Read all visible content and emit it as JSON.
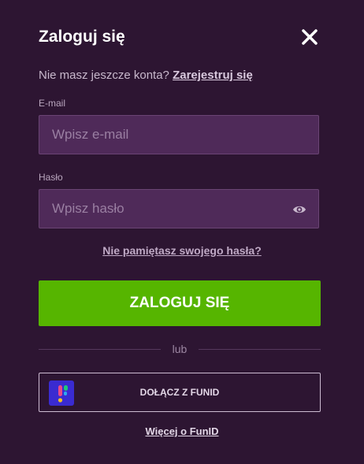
{
  "modal": {
    "title": "Zaloguj się"
  },
  "register": {
    "prompt": "Nie masz jeszcze konta?",
    "link_label": "Zarejestruj się"
  },
  "email": {
    "label": "E-mail",
    "placeholder": "Wpisz e-mail",
    "value": ""
  },
  "password": {
    "label": "Hasło",
    "placeholder": "Wpisz hasło",
    "value": ""
  },
  "forgot_password_label": "Nie pamiętasz swojego hasła?",
  "login_button_label": "ZALOGUJ SIĘ",
  "divider_label": "lub",
  "funid": {
    "button_label": "DOŁĄCZ Z FUNID",
    "more_label": "Więcej o FunID"
  },
  "icons": {
    "close": "close-icon",
    "eye": "eye-icon",
    "funid_logo": "funid-logo-icon"
  },
  "colors": {
    "background": "#2d1532",
    "field_background": "#4f2a59",
    "primary_button": "#56b500",
    "funid_logo_background": "#3a2bd1"
  }
}
